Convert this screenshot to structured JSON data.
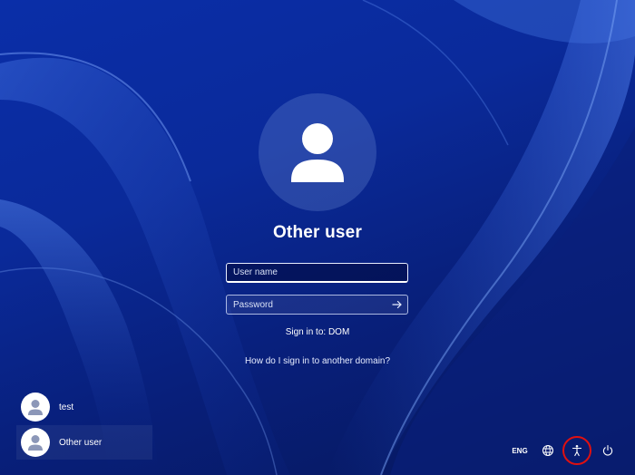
{
  "login": {
    "title": "Other user",
    "username": {
      "placeholder": "User name",
      "value": ""
    },
    "password": {
      "placeholder": "Password",
      "value": ""
    },
    "submit_icon": "arrow-right-icon",
    "sign_in_to": "Sign in to: DOM",
    "domain_help_link": "How do I sign in to another domain?"
  },
  "users": [
    {
      "name": "test",
      "icon": "user-avatar-icon",
      "selected": false
    },
    {
      "name": "Other user",
      "icon": "user-avatar-icon",
      "selected": true
    }
  ],
  "tray": {
    "language": "ENG",
    "network_icon": "network-icon",
    "accessibility_icon": "accessibility-icon",
    "power_icon": "power-icon"
  },
  "colors": {
    "background": "#0a2ea8",
    "highlight_ring": "#e01010",
    "text": "#ffffff"
  }
}
